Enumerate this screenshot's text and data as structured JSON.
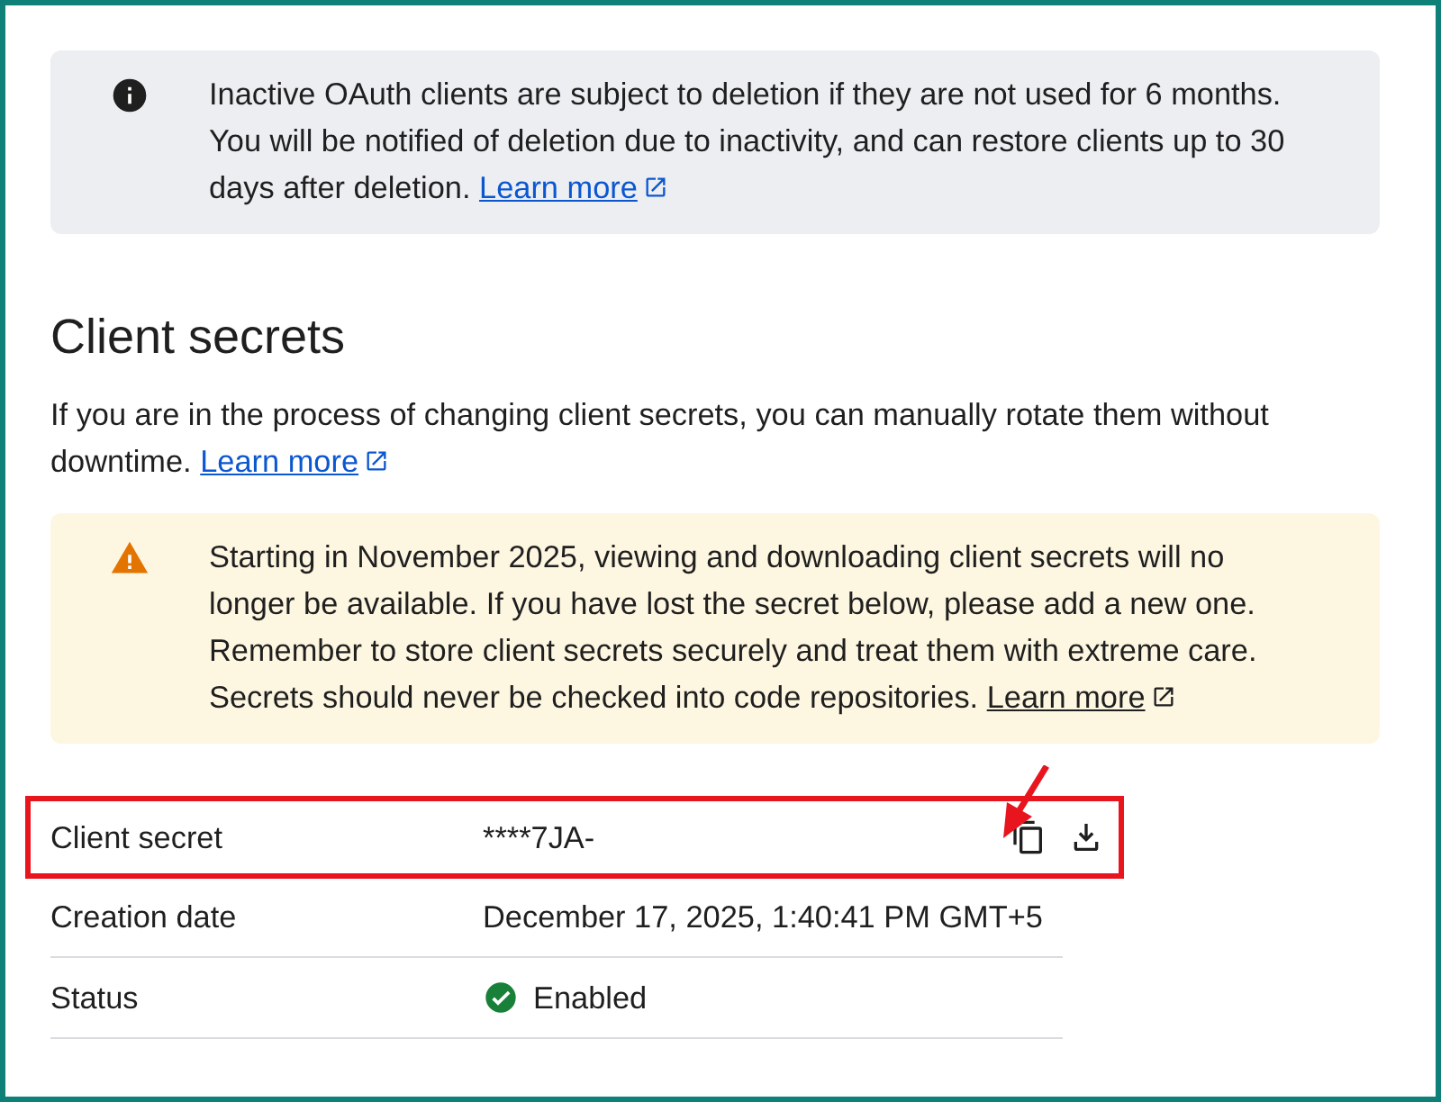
{
  "info_notice": {
    "kind": "info",
    "text": "Inactive OAuth clients are subject to deletion if they are not used for 6 months. You will be notified of deletion due to inactivity, and can restore clients up to 30 days after deletion.",
    "link": "Learn more"
  },
  "section": {
    "title": "Client secrets",
    "description": "If you are in the process of changing client secrets, you can manually rotate them without downtime.",
    "link": "Learn more"
  },
  "warning_notice": {
    "kind": "warning",
    "text": "Starting in November 2025, viewing and downloading client secrets will no longer be available. If you have lost the secret below, please add a new one. Remember to store client secrets securely and treat them with extreme care. Secrets should never be checked into code repositories.",
    "link": "Learn more"
  },
  "details": [
    {
      "kind": "secret",
      "label": "Client secret",
      "value": "****7JA-",
      "highlighted": true
    },
    {
      "kind": "text",
      "label": "Creation date",
      "value": "December 17, 2025, 1:40:41 PM GMT+5",
      "highlighted": false
    },
    {
      "kind": "status",
      "label": "Status",
      "value": "Enabled",
      "highlighted": false
    }
  ]
}
